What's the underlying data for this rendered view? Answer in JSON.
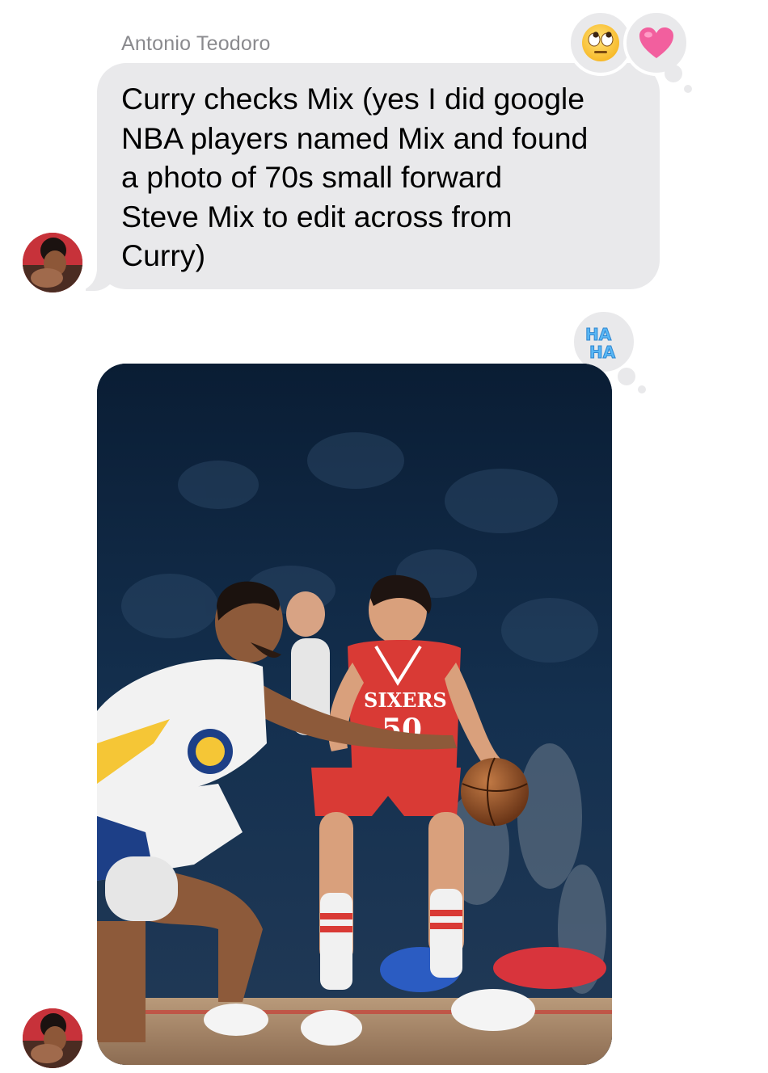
{
  "conversation": {
    "sender_name": "Antonio Teodoro",
    "text_message": "Curry checks Mix (yes I did google\nNBA players named Mix and found\na photo of 70s small forward\nSteve Mix to edit across from\nCurry)",
    "text_reactions": [
      "eye-roll-emoji-icon",
      "heart-icon"
    ],
    "photo_reaction": "haha-icon",
    "photo_jersey_text": "SIXERS",
    "photo_jersey_number": "50"
  },
  "colors": {
    "bubble_gray": "#e9e9eb",
    "sender_gray": "#8a8a8e",
    "heart_pink": "#f25f9e",
    "haha_blue": "#59b7f5",
    "sixers_red": "#d93a35",
    "warriors_gold": "#f5c636",
    "warriors_blue": "#1d3f87"
  }
}
